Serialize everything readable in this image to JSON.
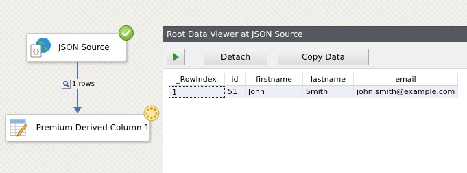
{
  "nodes": {
    "source": {
      "label": "JSON Source",
      "icon": "json-source-icon"
    },
    "derived": {
      "label": "Premium Derived Column 1",
      "icon": "derived-column-icon"
    }
  },
  "connector": {
    "rows_label": "1 rows",
    "icon": "data-viewer-magnifier-icon"
  },
  "status": {
    "source": "success-check-icon",
    "derived": "in-progress-icon"
  },
  "viewer": {
    "title": "Root Data Viewer at JSON Source",
    "toolbar": {
      "play_icon": "play-icon",
      "detach_label": "Detach",
      "copy_label": "Copy Data"
    },
    "columns": [
      "_RowIndex",
      "id",
      "firstname",
      "lastname",
      "email"
    ],
    "rows": [
      [
        "1",
        "51",
        "John",
        "Smith",
        "john.smith@example.com"
      ]
    ]
  },
  "colors": {
    "accent": "#4a73a8",
    "titlebar": "#55595f",
    "success": "#5fa31e",
    "row_highlight": "#ecf0f6"
  }
}
